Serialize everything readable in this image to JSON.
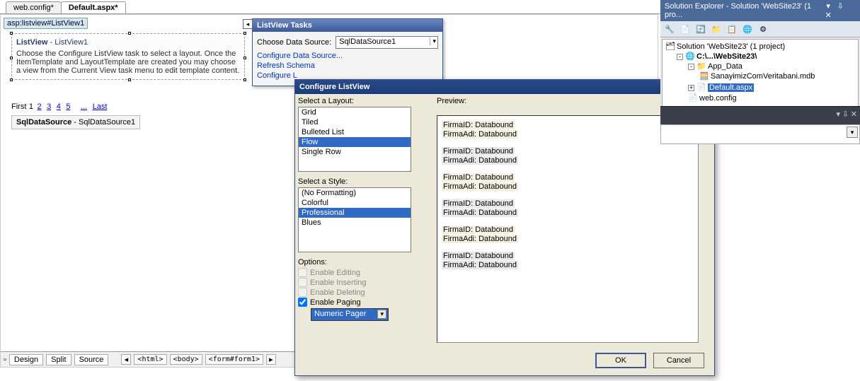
{
  "tabs": {
    "inactive": "web.config*",
    "active": "Default.aspx*"
  },
  "tag_crumb": "asp:listview#ListView1",
  "lv": {
    "title_bold": "ListView",
    "title_rest": " - ListView1",
    "help": "Choose the Configure ListView task to select a layout. Once the ItemTemplate and LayoutTemplate are created you may choose a view from the Current View task menu to edit template content."
  },
  "pager": {
    "first": "First",
    "p1": "1",
    "p2": "2",
    "p3": "3",
    "p4": "4",
    "p5": "5",
    "dots": "...",
    "last": "Last"
  },
  "sds": {
    "bold": "SqlDataSource",
    "rest": " - SqlDataSource1"
  },
  "views": {
    "design": "Design",
    "split": "Split",
    "source": "Source",
    "c1": "<html>",
    "c2": "<body>",
    "c3": "<form#form1>"
  },
  "smart": {
    "title": "ListView Tasks",
    "choose_ds": "Choose Data Source:",
    "ds_value": "SqlDataSource1",
    "link_cfgds": "Configure Data Source...",
    "link_refresh": "Refresh Schema",
    "link_cfglv": "Configure L"
  },
  "dialog": {
    "title": "Configure ListView",
    "sel_layout": "Select a Layout:",
    "layouts": {
      "i0": "Grid",
      "i1": "Tiled",
      "i2": "Bulleted List",
      "i3": "Flow",
      "i4": "Single Row"
    },
    "sel_style": "Select a Style:",
    "styles": {
      "i0": "(No Formatting)",
      "i1": "Colorful",
      "i2": "Professional",
      "i3": "Blues"
    },
    "options": "Options:",
    "opt_edit": "Enable Editing",
    "opt_insert": "Enable Inserting",
    "opt_delete": "Enable Deleting",
    "opt_paging": "Enable Paging",
    "pager_type": "Numeric Pager",
    "preview": "Preview:",
    "p_id": "FirmaID: Databound",
    "p_adi": "FirmaAdi: Databound",
    "ok": "OK",
    "cancel": "Cancel"
  },
  "solexp": {
    "title": "Solution Explorer - Solution 'WebSite23' (1 pro...",
    "root": "Solution 'WebSite23' (1 project)",
    "proj": "C:\\...\\WebSite23\\",
    "appdata": "App_Data",
    "mdb": "SanayimizComVeritabani.mdb",
    "default": "Default.aspx",
    "webconfig": "web.config"
  }
}
